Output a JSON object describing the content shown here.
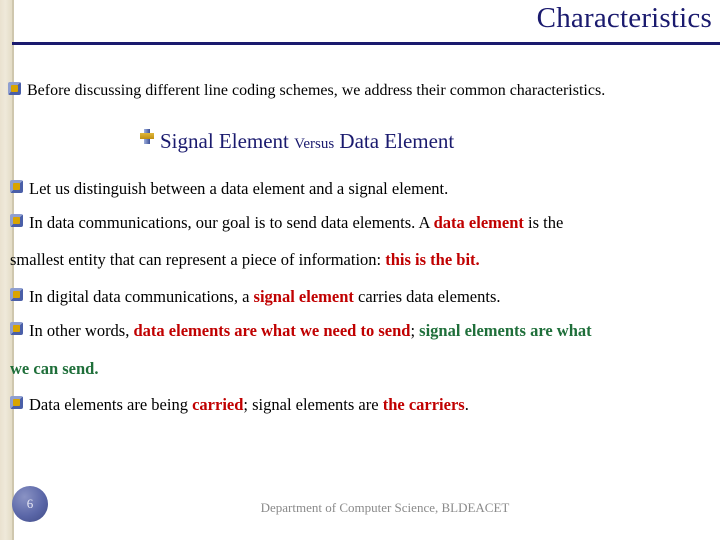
{
  "slide": {
    "title": "Characteristics",
    "intro": "Before discussing different line coding schemes, we address their common characteristics.",
    "subheading": {
      "part1": "Signal Element ",
      "versus": "Versus",
      "part2": " Data Element"
    },
    "bullets": {
      "b1": "Let us distinguish between a data element and a signal element.",
      "b2": {
        "seg1": "In data communications, our goal is to send data elements. A ",
        "seg2_red": "data element",
        "seg3": " is the smallest entity that can represent a piece of information: ",
        "seg4_red": "this is the bit."
      },
      "b3": {
        "seg1": "In digital data communications, a ",
        "seg2_red": "signal element",
        "seg3": " carries data elements."
      },
      "b4": {
        "seg1": "In other words, ",
        "seg2_red": "data elements are what we need to send",
        "seg3": "; ",
        "seg4_green": "signal elements are what we can send."
      },
      "b5": {
        "seg1": "Data elements are being ",
        "seg2_red": "carried",
        "seg3": "; signal elements are ",
        "seg4_red": "the carriers",
        "seg5": "."
      }
    },
    "footer": {
      "page_number": "6",
      "text": "Department of Computer Science, BLDEACET"
    },
    "colors": {
      "title": "#1a1a6e",
      "accent_red": "#c00000",
      "accent_green": "#1f6f3a",
      "band": "#e9e2cf"
    },
    "icons": {
      "bullet": "square-bullet-icon",
      "heading_bullet": "cross-bullet-icon"
    }
  }
}
